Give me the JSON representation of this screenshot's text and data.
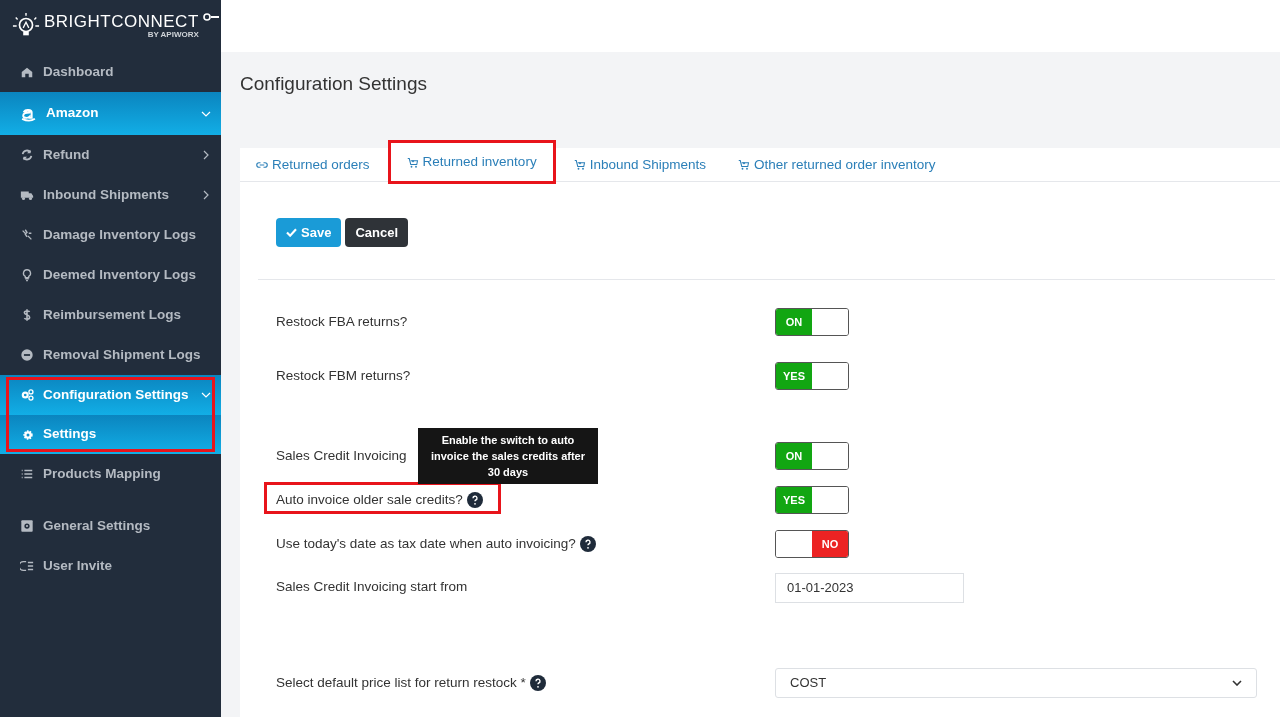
{
  "brand": {
    "name": "BRIGHTCONNECT",
    "tagline": "BY APIWORX"
  },
  "sidebar": {
    "items": [
      {
        "label": "Dashboard",
        "selected": false,
        "highlighted": false
      },
      {
        "label": "Amazon",
        "selected": true,
        "highlighted": false
      },
      {
        "label": "Refund",
        "selected": false,
        "highlighted": false
      },
      {
        "label": "Inbound Shipments",
        "selected": false,
        "highlighted": false
      },
      {
        "label": "Damage Inventory Logs",
        "selected": false,
        "highlighted": false
      },
      {
        "label": "Deemed Inventory Logs",
        "selected": false,
        "highlighted": false
      },
      {
        "label": "Reimbursement Logs",
        "selected": false,
        "highlighted": false
      },
      {
        "label": "Removal Shipment Logs",
        "selected": false,
        "highlighted": false
      },
      {
        "label": "Configuration Settings",
        "selected": true,
        "highlighted": true,
        "children": [
          {
            "label": "Settings",
            "selected": true
          }
        ]
      },
      {
        "label": "Products Mapping",
        "selected": false,
        "highlighted": false
      },
      {
        "label": "General Settings",
        "selected": false,
        "highlighted": false
      },
      {
        "label": "User Invite",
        "selected": false,
        "highlighted": false
      }
    ]
  },
  "page": {
    "title": "Configuration Settings"
  },
  "tabs": [
    {
      "label": "Returned orders",
      "selected": false,
      "highlighted": false
    },
    {
      "label": "Returned inventory",
      "selected": true,
      "highlighted": true
    },
    {
      "label": "Inbound Shipments",
      "selected": false,
      "highlighted": false
    },
    {
      "label": "Other returned order inventory",
      "selected": false,
      "highlighted": false
    }
  ],
  "buttons": {
    "save": "Save",
    "cancel": "Cancel"
  },
  "settings": [
    {
      "kind": "toggle",
      "label": "Restock FBA returns?",
      "highlighted": false,
      "on": true,
      "on_text": "ON"
    },
    {
      "kind": "toggle",
      "label": "Restock FBM returns?",
      "highlighted": false,
      "on": true,
      "on_text": "YES"
    },
    {
      "kind": "toggle",
      "label": "Sales Credit Invoicing",
      "highlighted": false,
      "on": true,
      "on_text": "ON"
    },
    {
      "kind": "toggle",
      "label": "Auto invoice older sale credits?",
      "highlighted": true,
      "on": true,
      "on_text": "YES",
      "tooltip": "Enable the switch to auto invoice the sales credits after 30 days"
    },
    {
      "kind": "toggle",
      "label": "Use today's date as tax date when auto invoicing?",
      "highlighted": false,
      "on": false,
      "off_text": "NO"
    },
    {
      "kind": "date",
      "label": "Sales Credit Invoicing start from",
      "highlighted": false,
      "value": "01-01-2023"
    },
    {
      "kind": "select",
      "label": "Select default price list for return restock *",
      "highlighted": false,
      "value": "COST"
    }
  ]
}
